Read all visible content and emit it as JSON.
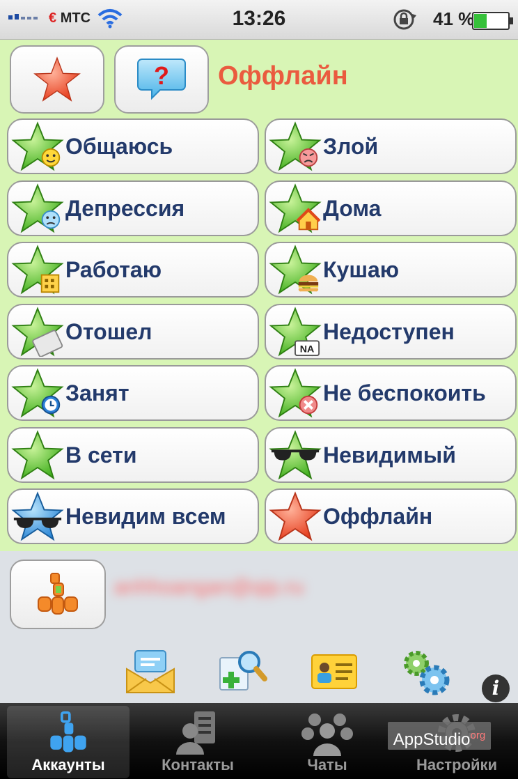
{
  "status_bar": {
    "carrier": "МТС",
    "time": "13:26",
    "battery_percent": "41 %",
    "battery_level": 0.41
  },
  "header": {
    "current_status": "Оффлайн"
  },
  "statuses": [
    {
      "label": "Общаюсь",
      "icon": "star-smile-icon"
    },
    {
      "label": "Злой",
      "icon": "star-angry-icon"
    },
    {
      "label": "Депрессия",
      "icon": "star-sad-icon"
    },
    {
      "label": "Дома",
      "icon": "star-home-icon"
    },
    {
      "label": "Работаю",
      "icon": "star-work-icon"
    },
    {
      "label": "Кушаю",
      "icon": "star-burger-icon"
    },
    {
      "label": "Отошел",
      "icon": "star-away-icon"
    },
    {
      "label": "Недоступен",
      "icon": "star-na-icon"
    },
    {
      "label": "Занят",
      "icon": "star-busy-icon"
    },
    {
      "label": "Не беспокоить",
      "icon": "star-dnd-icon"
    },
    {
      "label": "В сети",
      "icon": "star-online-icon"
    },
    {
      "label": "Невидимый",
      "icon": "star-invisible-icon"
    },
    {
      "label": "Невидим всем",
      "icon": "star-invisible-all-icon"
    },
    {
      "label": "Оффлайн",
      "icon": "star-offline-icon"
    }
  ],
  "na_badge": "NA",
  "account": {
    "email_blurred": "anhhoangan@qip.ru"
  },
  "tabs": [
    {
      "label": "Аккаунты",
      "icon": "qip-accounts-icon",
      "active": true
    },
    {
      "label": "Контакты",
      "icon": "contacts-icon",
      "active": false
    },
    {
      "label": "Чаты",
      "icon": "chats-icon",
      "active": false
    },
    {
      "label": "Настройки",
      "icon": "settings-icon",
      "active": false
    }
  ],
  "watermark": {
    "text": "AppStudio",
    "suffix": "org"
  },
  "info_glyph": "i",
  "colors": {
    "status_bg": "#d8f5b5",
    "offline_red": "#ea5b3f",
    "label_blue": "#233a6b"
  }
}
